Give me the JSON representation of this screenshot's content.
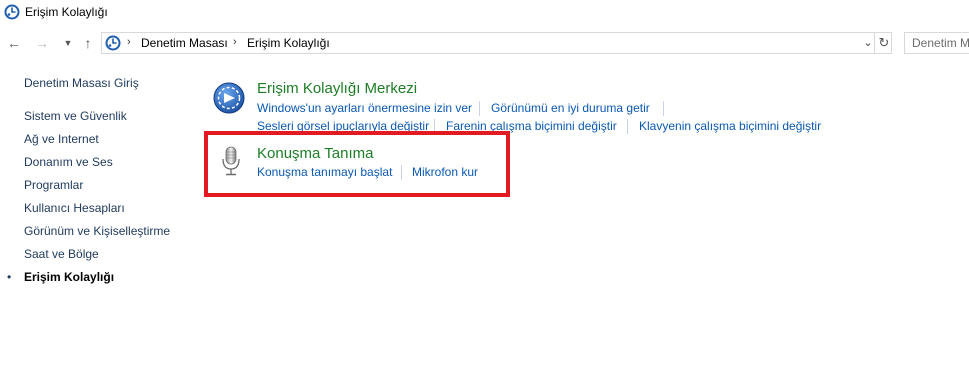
{
  "window": {
    "title": "Erişim Kolaylığı"
  },
  "address": {
    "crumbs": [
      "Denetim Masası",
      "Erişim Kolaylığı"
    ],
    "search_placeholder": "Denetim M"
  },
  "sidebar": {
    "home": "Denetim Masası Giriş",
    "items": [
      {
        "label": "Sistem ve Güvenlik"
      },
      {
        "label": "Ağ ve Internet"
      },
      {
        "label": "Donanım ve Ses"
      },
      {
        "label": "Programlar"
      },
      {
        "label": "Kullanıcı Hesapları"
      },
      {
        "label": "Görünüm ve Kişiselleştirme"
      },
      {
        "label": "Saat ve Bölge"
      },
      {
        "label": "Erişim Kolaylığı"
      }
    ],
    "active_bullet": "•"
  },
  "main": {
    "ease_center": {
      "title": "Erişim Kolaylığı Merkezi",
      "links_row1": [
        "Windows'un ayarları önermesine izin ver",
        "Görünümü en iyi duruma getir"
      ],
      "links_row2": [
        "Sesleri görsel ipuçlarıyla değiştir",
        "Farenin çalışma biçimini değiştir",
        "Klavyenin çalışma biçimini değiştir"
      ]
    },
    "speech": {
      "title": "Konuşma Tanıma",
      "links": [
        "Konuşma tanımayı başlat",
        "Mikrofon kur"
      ]
    }
  },
  "colors": {
    "category_title": "#1e7d26",
    "link": "#0b58b1",
    "highlight": "#e21a22"
  },
  "icons": {
    "app": "control-panel-icon",
    "ease_center": "ease-of-access-icon",
    "speech": "microphone-icon"
  }
}
